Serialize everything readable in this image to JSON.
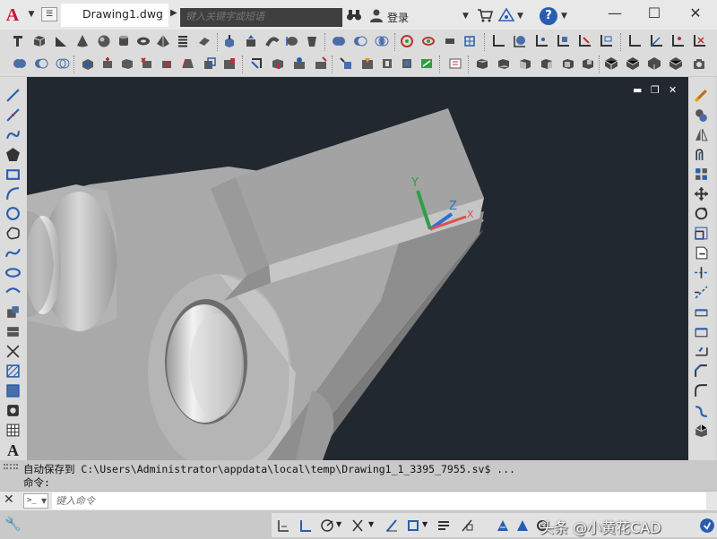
{
  "app": {
    "logo_letter": "A",
    "file_tab": "Drawing1.dwg",
    "search_placeholder": "键入关键字或短语",
    "login": "登录",
    "help": "?"
  },
  "window_controls": {
    "minimize": "—",
    "maximize": "☐",
    "close": "✕"
  },
  "viewport": {
    "controls": [
      "▬",
      "❐",
      "✕"
    ],
    "ucs_labels": {
      "y": "Y",
      "z": "Z",
      "x": "X"
    }
  },
  "command": {
    "history_1": "自动保存到 C:\\Users\\Administrator\\appdata\\local\\temp\\Drawing1_1_3395_7955.sv$ ...",
    "history_2": "命令:",
    "input_placeholder": "键入命令",
    "prompt_icon": ">_"
  },
  "watermark": "头条 @小黄花CAD",
  "colors": {
    "viewport_bg": "#212830",
    "ucs_y": "#2ea043",
    "ucs_z": "#2f6fd1",
    "ucs_x": "#e05050",
    "logo_red": "#c8102e"
  }
}
